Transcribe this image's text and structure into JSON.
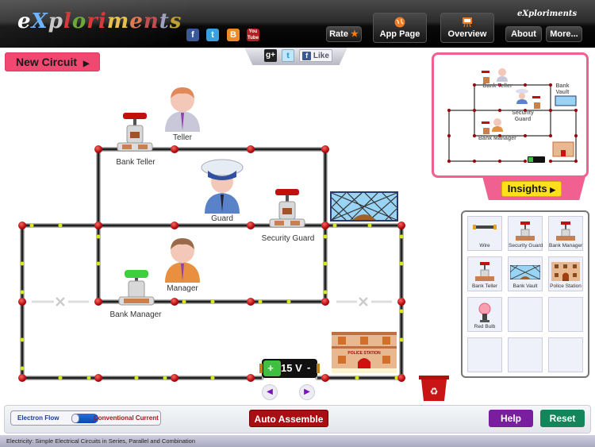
{
  "header": {
    "logo": "eXploriments",
    "social": [
      "facebook",
      "twitter",
      "blogger",
      "youtube"
    ],
    "buttons": {
      "rate": "Rate",
      "app_page": "App Page",
      "overview": "Overview",
      "about": "About",
      "more": "More..."
    },
    "mini_logo": "eXploriments"
  },
  "toolbar": {
    "new_circuit": "New Circuit",
    "share": {
      "gplus": "g+",
      "twitter": "t",
      "like": "Like"
    }
  },
  "circuit": {
    "labels": {
      "bank_teller": "Bank Teller",
      "teller": "Teller",
      "guard": "Guard",
      "security_guard": "Security Guard",
      "manager": "Manager",
      "bank_manager": "Bank Manager"
    },
    "battery": {
      "voltage": "15 V",
      "plus": "+",
      "minus": "-"
    }
  },
  "preview": {
    "labels": {
      "bank_teller": "Bank Teller",
      "bank_vault": "Bank Vault",
      "security_guard": "Security Guard",
      "bank_manager": "Bank Manager"
    },
    "insights": "Insights"
  },
  "palette": {
    "items": [
      {
        "label": "Wire",
        "icon": "wire-icon"
      },
      {
        "label": "Security Guard",
        "icon": "switch-icon"
      },
      {
        "label": "Bank Manager",
        "icon": "switch-icon"
      },
      {
        "label": "Bank Teller",
        "icon": "switch-icon"
      },
      {
        "label": "Bank Vault",
        "icon": "vault-icon"
      },
      {
        "label": "Police Station",
        "icon": "police-station-icon"
      },
      {
        "label": "Red Bulb",
        "icon": "bulb-icon"
      },
      {
        "label": "",
        "icon": ""
      },
      {
        "label": "",
        "icon": ""
      },
      {
        "label": "",
        "icon": ""
      },
      {
        "label": "",
        "icon": ""
      },
      {
        "label": "",
        "icon": ""
      }
    ]
  },
  "bottom": {
    "electron_flow": "Electron Flow",
    "conventional_current": "Conventional Current",
    "auto_assemble": "Auto Assemble",
    "help": "Help",
    "reset": "Reset",
    "colors": {
      "auto_assemble": "#a80f14",
      "help": "#7a1ea0",
      "reset": "#13855a"
    }
  },
  "status": "Electricity: Simple Electrical Circuits in Series, Parallel and Combination"
}
